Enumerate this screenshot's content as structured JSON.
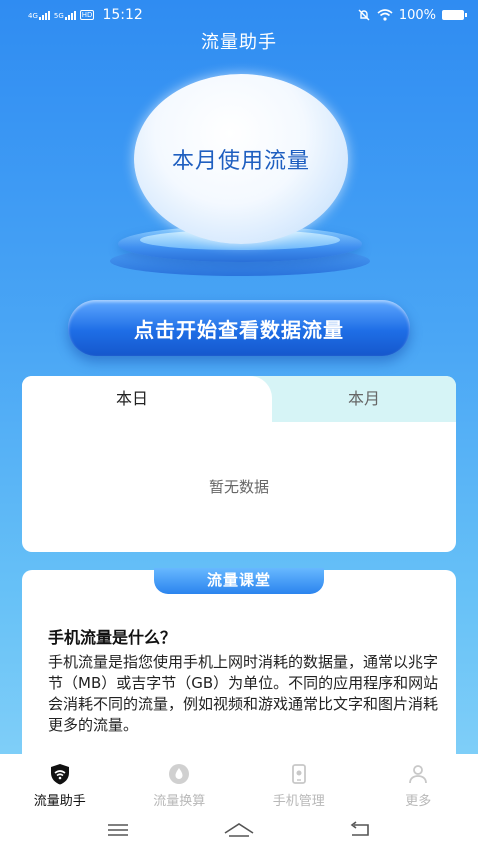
{
  "status_bar": {
    "network_1": "4G",
    "network_2": "5G",
    "hd_badge": "HD",
    "time": "15:12",
    "battery": "100%"
  },
  "header": {
    "title": "流量助手"
  },
  "hero": {
    "bubble_text": "本月使用流量"
  },
  "cta": {
    "label": "点击开始查看数据流量"
  },
  "usage_card": {
    "tabs": [
      {
        "label": "本日",
        "active": true
      },
      {
        "label": "本月",
        "active": false
      }
    ],
    "empty_text": "暂无数据"
  },
  "lesson": {
    "badge": "流量课堂",
    "title": "手机流量是什么？",
    "body": "手机流量是指您使用手机上网时消耗的数据量，通常以兆字节（MB）或吉字节（GB）为单位。不同的应用程序和网站会消耗不同的流量，例如视频和游戏通常比文字和图片消耗更多的流量。"
  },
  "bottom_nav": {
    "items": [
      {
        "label": "流量助手",
        "icon": "wifi-shield-icon",
        "active": true
      },
      {
        "label": "流量换算",
        "icon": "drop-icon",
        "active": false
      },
      {
        "label": "手机管理",
        "icon": "phone-icon",
        "active": false
      },
      {
        "label": "更多",
        "icon": "user-icon",
        "active": false
      }
    ]
  },
  "colors": {
    "primary": "#1e6ee6",
    "tab_inactive_bg": "#d6f4f6",
    "bubble_text": "#1f5fc0"
  }
}
